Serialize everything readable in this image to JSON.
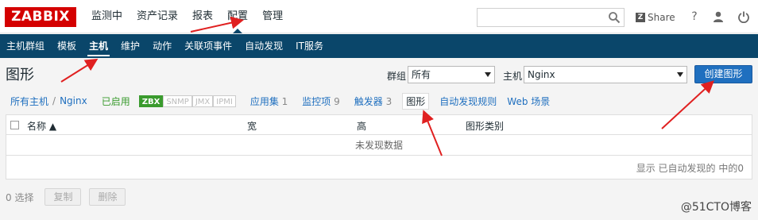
{
  "logo": "ZABBIX",
  "top_nav": [
    {
      "label": "监测中"
    },
    {
      "label": "资产记录"
    },
    {
      "label": "报表"
    },
    {
      "label": "配置"
    },
    {
      "label": "管理"
    }
  ],
  "top_nav_selected": "配置",
  "search": {
    "placeholder": ""
  },
  "share_label": "Share",
  "help_label": "?",
  "sub_nav": [
    {
      "label": "主机群组"
    },
    {
      "label": "模板"
    },
    {
      "label": "主机"
    },
    {
      "label": "维护"
    },
    {
      "label": "动作"
    },
    {
      "label": "关联项事件"
    },
    {
      "label": "自动发现"
    },
    {
      "label": "IT服务"
    }
  ],
  "sub_nav_selected": "主机",
  "page_title": "图形",
  "filters": {
    "group_label": "群组",
    "group_value": "所有",
    "host_label": "主机",
    "host_value": "Nginx"
  },
  "create_button": "创建图形",
  "breadcrumb": {
    "all_hosts": "所有主机",
    "separator": "/",
    "host": "Nginx",
    "status": "已启用",
    "badges": [
      "ZBX",
      "SNMP",
      "JMX",
      "IPMI"
    ]
  },
  "tabs": [
    {
      "label": "应用集",
      "count": "1"
    },
    {
      "label": "监控项",
      "count": "9"
    },
    {
      "label": "触发器",
      "count": "3"
    },
    {
      "label": "图形",
      "count": ""
    },
    {
      "label": "自动发现规则",
      "count": ""
    },
    {
      "label": "Web 场景",
      "count": ""
    }
  ],
  "table": {
    "columns": [
      "名称 ▲",
      "宽",
      "高",
      "图形类别"
    ],
    "empty_text": "未发现数据",
    "footer": "显示 已自动发现的 中的0"
  },
  "bottom": {
    "selected": "0 选择",
    "copy": "复制",
    "delete": "删除"
  },
  "watermark": "@51CTO博客",
  "colors": {
    "brand_red": "#d40000",
    "nav_dark": "#0a466a",
    "link_blue": "#1f6fbf",
    "enabled_green": "#3a9b2e",
    "annotation_red": "#e02020"
  }
}
